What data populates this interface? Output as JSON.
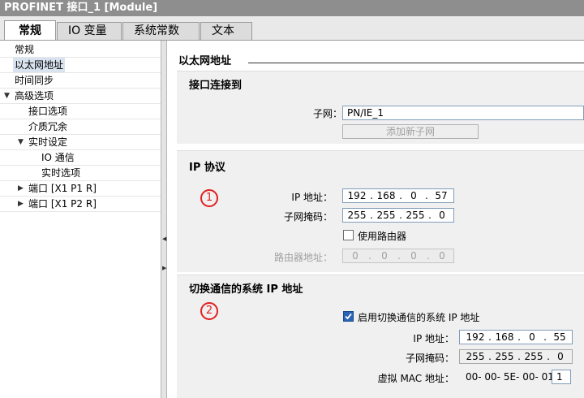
{
  "title": "PROFINET 接口_1 [Module]",
  "tabs": [
    "常规",
    "IO 变量",
    "系统常数",
    "文本"
  ],
  "nav": {
    "items": [
      "常规",
      "以太网地址",
      "时间同步",
      "高级选项",
      "接口选项",
      "介质冗余",
      "实时设定",
      "IO 通信",
      "实时选项",
      "端口 [X1 P1 R]",
      "端口 [X1 P2 R]"
    ]
  },
  "section_heading": "以太网地址",
  "interface": {
    "title": "接口连接到",
    "subnet_label": "子网：",
    "subnet_value": "PN/IE_1",
    "add_subnet_button": "添加新子网"
  },
  "ip": {
    "title": "IP 协议",
    "callout": "1",
    "ip_label": "IP 地址：",
    "ip_octets": [
      "192",
      "168",
      "0",
      "57"
    ],
    "mask_label": "子网掩码：",
    "mask_octets": [
      "255",
      "255",
      "255",
      "0"
    ],
    "router_checkbox_label": "使用路由器",
    "router_checked": false,
    "router_label": "路由器地址：",
    "router_octets": [
      "0",
      "0",
      "0",
      "0"
    ]
  },
  "switch": {
    "title": "切换通信的系统 IP 地址",
    "callout": "2",
    "enable_label": "启用切换通信的系统 IP 地址",
    "enable_checked": true,
    "ip_label": "IP 地址：",
    "ip_octets": [
      "192",
      "168",
      "0",
      "55"
    ],
    "mask_label": "子网掩码：",
    "mask_octets": [
      "255",
      "255",
      "255",
      "0"
    ],
    "mac_label": "虚拟 MAC 地址：",
    "mac_prefix": "00- 00- 5E- 00- 01-",
    "mac_suffix": "1"
  },
  "colors": {
    "titlebar": "#8e8e8e",
    "panel": "#f0f0f0",
    "callout": "#e02020",
    "checkbox": "#2a64b4",
    "selected_nav": "#d8e3ef"
  }
}
